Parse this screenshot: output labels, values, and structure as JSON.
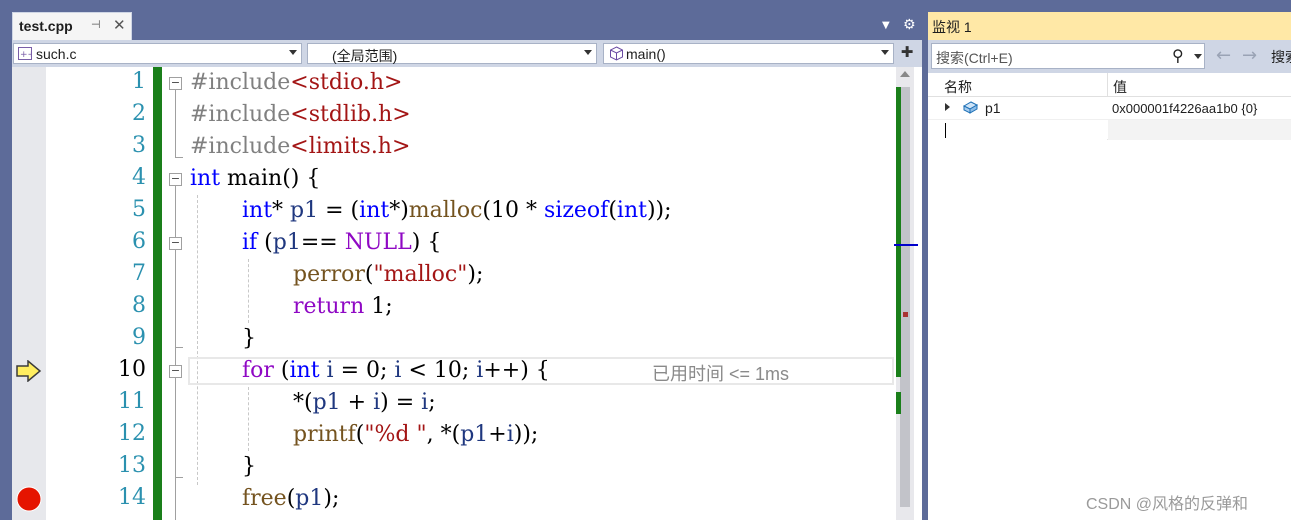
{
  "editor_tab": {
    "label": "test.cpp",
    "pin_icon": "pin-icon",
    "close_icon": "close-icon"
  },
  "navbar": {
    "project": "such.c",
    "scope": "(全局范围)",
    "member": "main()"
  },
  "code_lines": [
    {
      "n": "1"
    },
    {
      "n": "2"
    },
    {
      "n": "3"
    },
    {
      "n": "4"
    },
    {
      "n": "5"
    },
    {
      "n": "6"
    },
    {
      "n": "7"
    },
    {
      "n": "8"
    },
    {
      "n": "9"
    },
    {
      "n": "10"
    },
    {
      "n": "11"
    },
    {
      "n": "12"
    },
    {
      "n": "13"
    },
    {
      "n": "14"
    }
  ],
  "code": {
    "l1": [
      "#include",
      "<stdio.h>"
    ],
    "l2": [
      "#include",
      "<stdlib.h>"
    ],
    "l3": [
      "#include",
      "<limits.h>"
    ],
    "l4": [
      "int",
      " main() {"
    ],
    "l5": [
      "int",
      "* ",
      "p1",
      " = (",
      "int",
      "*)",
      "malloc",
      "(10 * ",
      "sizeof",
      "(",
      "int",
      "));"
    ],
    "l6": [
      "if",
      " (",
      "p1",
      "== ",
      "NULL",
      ") {"
    ],
    "l7": [
      "perror",
      "(",
      "\"malloc\"",
      ");"
    ],
    "l8": [
      "return",
      " 1;"
    ],
    "l9": [
      "}"
    ],
    "l10": [
      "for",
      " (",
      "int",
      " ",
      "i",
      " = 0; ",
      "i",
      " < 10; ",
      "i",
      "++) {"
    ],
    "l11": [
      "*(",
      "p1",
      " + ",
      "i",
      ") = ",
      "i",
      ";"
    ],
    "l12": [
      "printf",
      "(",
      "\"%d \"",
      ", *(",
      "p1",
      "+",
      "i",
      "));"
    ],
    "l13": [
      "}"
    ],
    "l14": [
      "free",
      "(",
      "p1",
      ");"
    ]
  },
  "perf_tip": "已用时间 <= 1ms",
  "current_line": "10",
  "breakpoint_line": "14",
  "watch": {
    "title": "监视 1",
    "search_placeholder": "搜索(Ctrl+E)",
    "search_depth_label": "搜索",
    "col_name": "名称",
    "col_value": "值",
    "rows": [
      {
        "name": "p1",
        "value": "0x000001f4226aa1b0 {0}"
      }
    ]
  },
  "watermark": "CSDN @风格的反弹和",
  "colors": {
    "keyword": "#0000ff",
    "string": "#a31515",
    "preprocessor": "#808080",
    "function": "#74531f",
    "macro": "#8f08c4",
    "variable": "#1f377f",
    "watch_title_bg": "#ffe8a6",
    "chrome": "#5d6b99"
  }
}
